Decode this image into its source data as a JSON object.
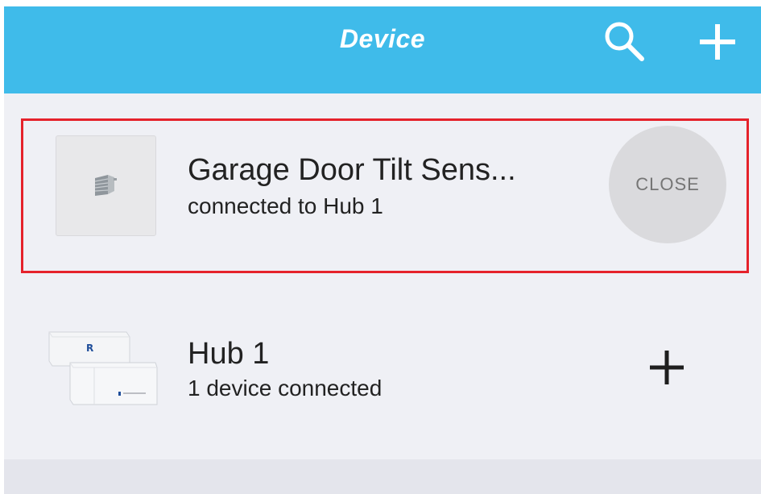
{
  "header": {
    "title": "Device",
    "search_icon": "search-icon",
    "add_icon": "plus-icon",
    "background_color": "#3fbbea"
  },
  "devices": [
    {
      "name": "Garage Door Tilt Sens...",
      "status": "connected to Hub 1",
      "action_label": "CLOSE",
      "icon": "garage-door-icon",
      "highlighted": true,
      "highlight_color": "#e5222b"
    },
    {
      "name": "Hub 1",
      "status": "1 device connected",
      "action_icon": "plus-icon",
      "icon": "hub-device-icon"
    }
  ]
}
